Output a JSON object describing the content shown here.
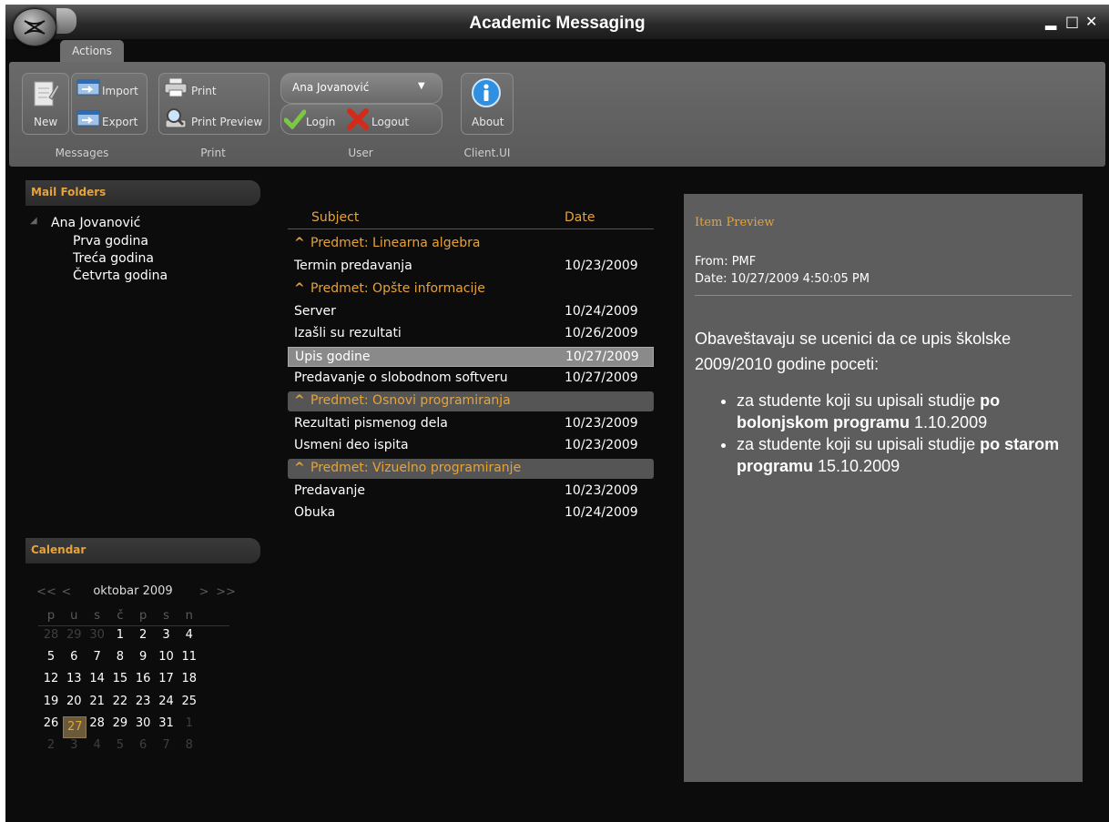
{
  "window": {
    "title": "Academic Messaging",
    "min_glyph": "▂",
    "max_glyph": "□",
    "close_glyph": "✕"
  },
  "ribbon": {
    "tab": "Actions",
    "groups": {
      "messages": {
        "label": "Messages",
        "new_label": "New",
        "import_label": "Import",
        "export_label": "Export"
      },
      "print": {
        "label": "Print",
        "print_label": "Print",
        "preview_label": "Print Preview"
      },
      "user": {
        "label": "User",
        "selected_user": "Ana Jovanović",
        "login_label": "Login",
        "logout_label": "Logout"
      },
      "client": {
        "label": "Client.UI",
        "about_label": "About"
      }
    }
  },
  "mail_folders": {
    "header": "Mail Folders",
    "root": "Ana Jovanović",
    "children": [
      "Prva godina",
      "Treća godina",
      "Četvrta godina"
    ]
  },
  "calendar": {
    "header": "Calendar",
    "month": "oktobar 2009",
    "nav_prev2": "<<",
    "nav_prev": "<",
    "nav_next": ">",
    "nav_next2": ">>",
    "weekdays": [
      "p",
      "u",
      "s",
      "č",
      "p",
      "s",
      "n"
    ],
    "weeks": [
      [
        "28",
        "29",
        "30",
        "1",
        "2",
        "3",
        "4"
      ],
      [
        "5",
        "6",
        "7",
        "8",
        "9",
        "10",
        "11"
      ],
      [
        "12",
        "13",
        "14",
        "15",
        "16",
        "17",
        "18"
      ],
      [
        "19",
        "20",
        "21",
        "22",
        "23",
        "24",
        "25"
      ],
      [
        "26",
        "27",
        "28",
        "29",
        "30",
        "31",
        "1"
      ],
      [
        "2",
        "3",
        "4",
        "5",
        "6",
        "7",
        "8"
      ]
    ],
    "selected_day": "27"
  },
  "messages": {
    "col_subject": "Subject",
    "col_date": "Date",
    "rows": [
      {
        "type": "group",
        "subject": "Predmet: Linearna algebra"
      },
      {
        "type": "msg",
        "subject": "Termin predavanja",
        "date": "10/23/2009"
      },
      {
        "type": "group",
        "subject": "Predmet: Opšte informacije"
      },
      {
        "type": "msg",
        "subject": "Server",
        "date": "10/24/2009"
      },
      {
        "type": "msg",
        "subject": "Izašli su rezultati",
        "date": "10/26/2009"
      },
      {
        "type": "msg",
        "subject": "Upis godine",
        "date": "10/27/2009",
        "selected": true
      },
      {
        "type": "msg",
        "subject": "Predavanje o slobodnom softveru",
        "date": "10/27/2009"
      },
      {
        "type": "group",
        "subject": "Predmet: Osnovi programiranja",
        "highlight": true
      },
      {
        "type": "msg",
        "subject": "Rezultati pismenog dela",
        "date": "10/23/2009"
      },
      {
        "type": "msg",
        "subject": "Usmeni deo ispita",
        "date": "10/23/2009"
      },
      {
        "type": "group",
        "subject": "Predmet: Vizuelno programiranje",
        "highlight": true
      },
      {
        "type": "msg",
        "subject": "Predavanje",
        "date": "10/23/2009"
      },
      {
        "type": "msg",
        "subject": "Obuka",
        "date": "10/24/2009"
      }
    ]
  },
  "preview": {
    "title": "Item Preview",
    "from": "From: PMF",
    "date": "Date: 10/27/2009 4:50:05 PM",
    "intro": "Obaveštavaju se ucenici da ce upis školske 2009/2010 godine poceti:",
    "bullets": [
      {
        "pre": "za studente koji su upisali studije ",
        "bold": "po bolonjskom programu",
        "post": " 1.10.2009"
      },
      {
        "pre": "za studente koji su upisali studije ",
        "bold": "po starom programu",
        "post": " 15.10.2009"
      }
    ]
  },
  "colors": {
    "accent": "#e5a33a",
    "background": "#0c0c0c",
    "ribbon": "#616161",
    "preview_bg": "#5d5d5d"
  }
}
